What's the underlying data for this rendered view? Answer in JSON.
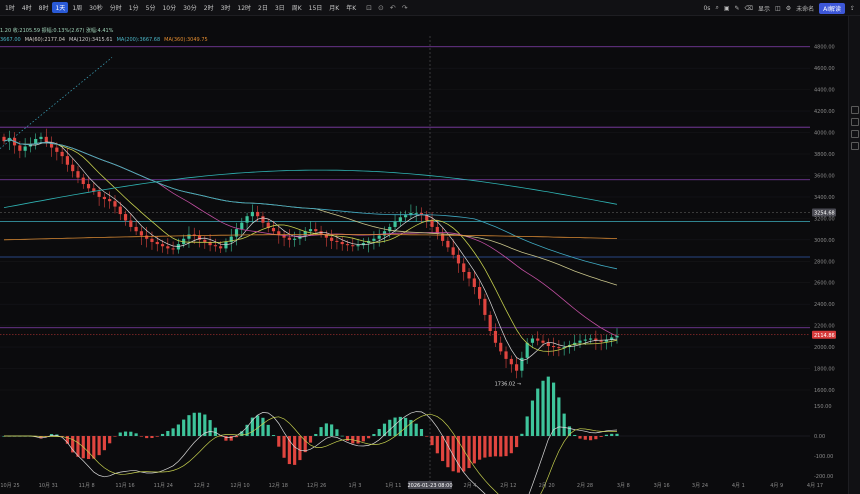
{
  "toolbar": {
    "timeframes": [
      "1时",
      "4时",
      "8时",
      "1天",
      "1周",
      "30秒",
      "分时",
      "1分",
      "5分",
      "10分",
      "30分",
      "2时",
      "3时",
      "12时",
      "2日",
      "3日",
      "周K",
      "15日",
      "月K",
      "年K"
    ],
    "active_timeframe": "1天",
    "icons": [
      "indicator-icon",
      "alert-icon",
      "undo-icon",
      "redo-icon"
    ],
    "right_items": [
      "0s",
      "",
      "",
      "",
      "",
      "显示",
      "",
      "",
      "未命名",
      "AI解读"
    ]
  },
  "legend": {
    "line1": "1.20  收:2105.59  振幅:0.13%(2.67)  涨幅:4.41%",
    "line2_parts": [
      {
        "text": "3667.00",
        "color": "#4ab5c6"
      },
      {
        "text": "MA(60):2177.04",
        "color": "#d4d0c8"
      },
      {
        "text": "MA(120):3415.61",
        "color": "#c9c9c9"
      },
      {
        "text": "MA(200):3667.68",
        "color": "#4ab5c6"
      },
      {
        "text": "MA(360):3049.75",
        "color": "#e08a2f"
      }
    ]
  },
  "price_axis": {
    "ticks": [
      4800,
      4600,
      4400,
      4200,
      4000,
      3800,
      3600,
      3400,
      3200,
      3000,
      2800,
      2600,
      2400,
      2200,
      2000,
      1800,
      1600
    ],
    "last_price_label": "2114.86",
    "crosshair_label": "3254.68",
    "low_marker": "1736.02"
  },
  "macd_axis": {
    "ticks": [
      "150.00",
      "0.00",
      "-100.00",
      "-200.00"
    ]
  },
  "time_axis": {
    "labels": [
      "10月 25",
      "10月 31",
      "11月 8",
      "11月 16",
      "11月 24",
      "12月 2",
      "12月 10",
      "12月 18",
      "12月 26",
      "1月 3",
      "1月 11",
      "1月 19",
      "2月 4",
      "2月 12",
      "2月 20",
      "2月 28",
      "3月 8",
      "3月 16",
      "3月 24",
      "4月 1",
      "4月 9",
      "4月 17"
    ],
    "crosshair_date": "2026-01-23 08:00"
  },
  "colors": {
    "bg": "#0b0b0d",
    "up": "#3ec49b",
    "down": "#e0453f",
    "ma_green_yellow": "#c5cf4e",
    "ma_white": "#d9d9d9",
    "ma_magenta": "#c14fa1",
    "ma_cyan": "#3fa8c0",
    "ma_orange": "#d98a34",
    "ma_teal": "#2fb3b3",
    "hline_purple": "#a24bd6",
    "hline_blue": "#3b6fd4",
    "hline_teal": "#40b9c8"
  },
  "chart_data": {
    "type": "candlestick",
    "title": "",
    "x_range": [
      "2025-10-25",
      "2026-04-17"
    ],
    "ylim": [
      1600,
      4900
    ],
    "closes": [
      3920,
      3950,
      3880,
      3830,
      3870,
      3890,
      3940,
      3960,
      3900,
      3860,
      3820,
      3780,
      3700,
      3640,
      3580,
      3520,
      3480,
      3450,
      3400,
      3380,
      3360,
      3310,
      3240,
      3180,
      3120,
      3080,
      3040,
      3010,
      2980,
      2960,
      2940,
      2920,
      2910,
      2960,
      3010,
      3050,
      3040,
      3000,
      2980,
      2950,
      2940,
      2920,
      2980,
      3030,
      3100,
      3160,
      3220,
      3260,
      3220,
      3160,
      3110,
      3080,
      3050,
      3020,
      3000,
      3010,
      3040,
      3080,
      3100,
      3080,
      3050,
      3020,
      2990,
      2980,
      2960,
      2950,
      2940,
      2950,
      2970,
      2990,
      3010,
      3040,
      3080,
      3120,
      3170,
      3210,
      3230,
      3250,
      3250,
      3230,
      3180,
      3120,
      3060,
      2990,
      2930,
      2860,
      2780,
      2700,
      2640,
      2560,
      2450,
      2300,
      2150,
      2040,
      1960,
      1890,
      1840,
      1780,
      1900,
      2040,
      2080,
      2060,
      2040,
      2010,
      2000,
      1990,
      2000,
      2020,
      2040,
      2060,
      2070,
      2080,
      2060,
      2050,
      2070,
      2090,
      2105
    ],
    "horizontal_lines": [
      4800,
      4050,
      3560,
      3170,
      2840,
      2180
    ],
    "macd_hist_range": [
      -200,
      150
    ]
  }
}
